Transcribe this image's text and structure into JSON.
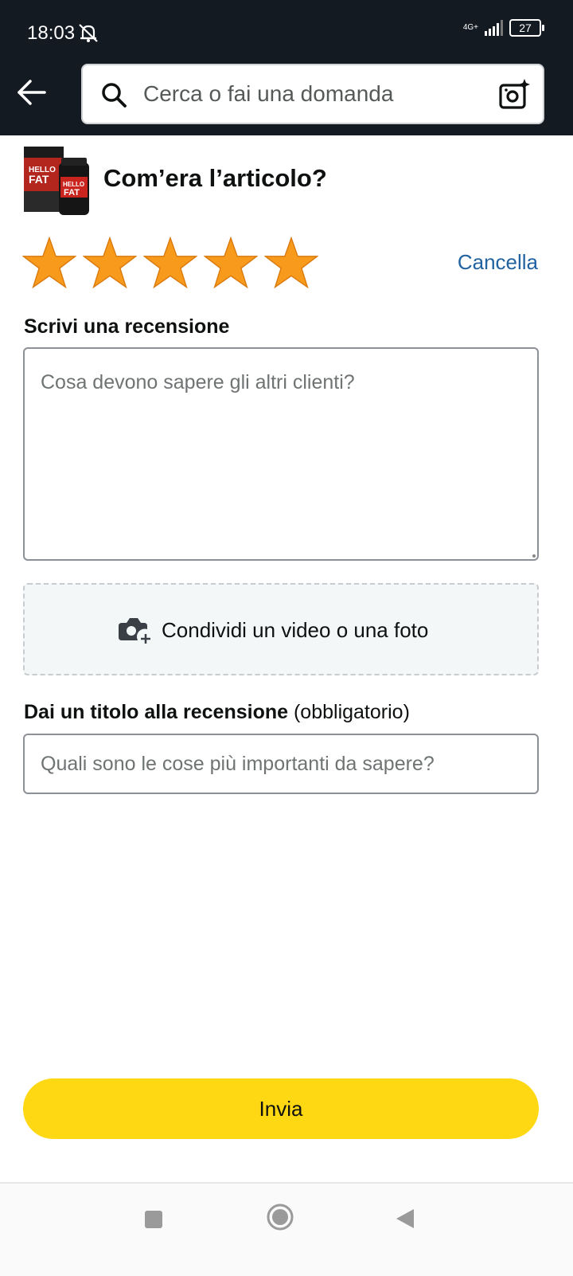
{
  "status_bar": {
    "time": "18:03",
    "network": "4G+",
    "battery": "27"
  },
  "header": {
    "search_placeholder": "Cerca o fai una domanda"
  },
  "product": {
    "question": "Com’era l’articolo?",
    "thumb_label": "HELLO FAT"
  },
  "rating": {
    "stars": 5,
    "max": 5,
    "clear_label": "Cancella",
    "star_color": "#f89a1c"
  },
  "review": {
    "label": "Scrivi una recensione",
    "placeholder": "Cosa devono sapere gli altri clienti?"
  },
  "media": {
    "label": "Condividi un video o una foto"
  },
  "title_field": {
    "label": "Dai un titolo alla recensione",
    "required": "(obbligatorio)",
    "placeholder": "Quali sono le cose più importanti da sapere?"
  },
  "submit": {
    "label": "Invia",
    "color": "#ffd814"
  },
  "colors": {
    "header_bg": "#131a22",
    "link": "#2162a1"
  }
}
